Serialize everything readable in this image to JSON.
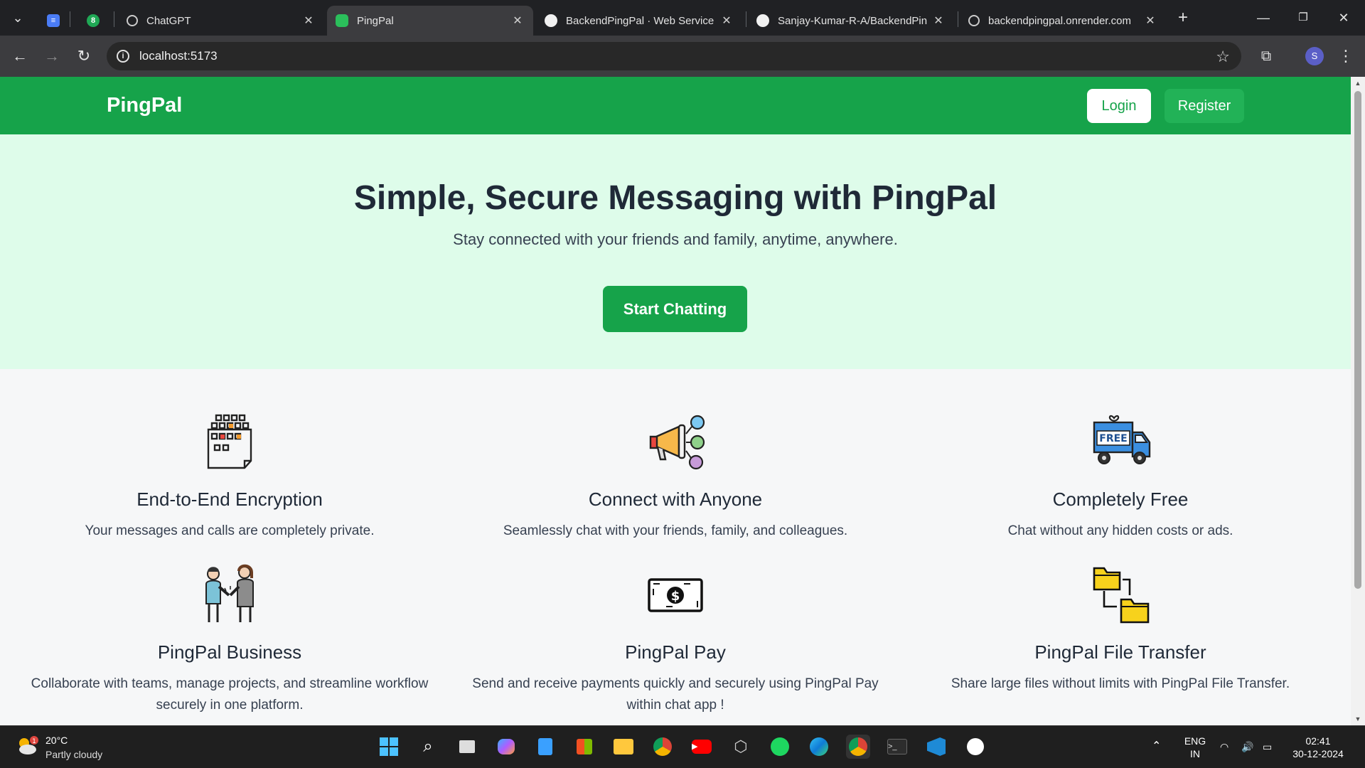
{
  "browser": {
    "tabs": [
      {
        "title": "ChatGPT",
        "icon": "chatgpt-icon"
      },
      {
        "title": "PingPal",
        "icon": "pingpal-chat-icon",
        "active": true
      },
      {
        "title": "BackendPingPal · Web Service",
        "icon": "render-icon"
      },
      {
        "title": "Sanjay-Kumar-R-A/BackendPin",
        "icon": "github-icon"
      },
      {
        "title": "backendpingpal.onrender.com",
        "icon": "globe-icon"
      }
    ],
    "badge_count": "8",
    "url": "localhost:5173",
    "profile_initial": "S"
  },
  "nav": {
    "brand": "PingPal",
    "login": "Login",
    "register": "Register"
  },
  "hero": {
    "title": "Simple, Secure Messaging with PingPal",
    "subtitle": "Stay connected with your friends and family, anytime, anywhere.",
    "cta": "Start Chatting"
  },
  "features": [
    {
      "title": "End-to-End Encryption",
      "desc": "Your messages and calls are completely private.",
      "icon": "encryption-grid-icon"
    },
    {
      "title": "Connect with Anyone",
      "desc": "Seamlessly chat with your friends, family, and colleagues.",
      "icon": "megaphone-icon"
    },
    {
      "title": "Completely Free",
      "desc": "Chat without any hidden costs or ads.",
      "icon": "free-truck-icon"
    },
    {
      "title": "PingPal Business",
      "desc": "Collaborate with teams, manage projects, and streamline workflow securely in one platform.",
      "icon": "handshake-icon"
    },
    {
      "title": "PingPal Pay",
      "desc": "Send and receive payments quickly and securely using PingPal Pay within chat app !",
      "icon": "dollar-bill-icon"
    },
    {
      "title": "PingPal File Transfer",
      "desc": "Share large files without limits with PingPal File Transfer.",
      "icon": "folders-icon"
    }
  ],
  "taskbar": {
    "weather_badge": "1",
    "temperature": "20°C",
    "condition": "Partly cloudy",
    "lang": "ENG",
    "region": "IN",
    "time": "02:41",
    "date": "30-12-2024"
  },
  "colors": {
    "brand_green": "#16a34a",
    "hero_bg": "#defcea",
    "register_green": "#22b257"
  }
}
